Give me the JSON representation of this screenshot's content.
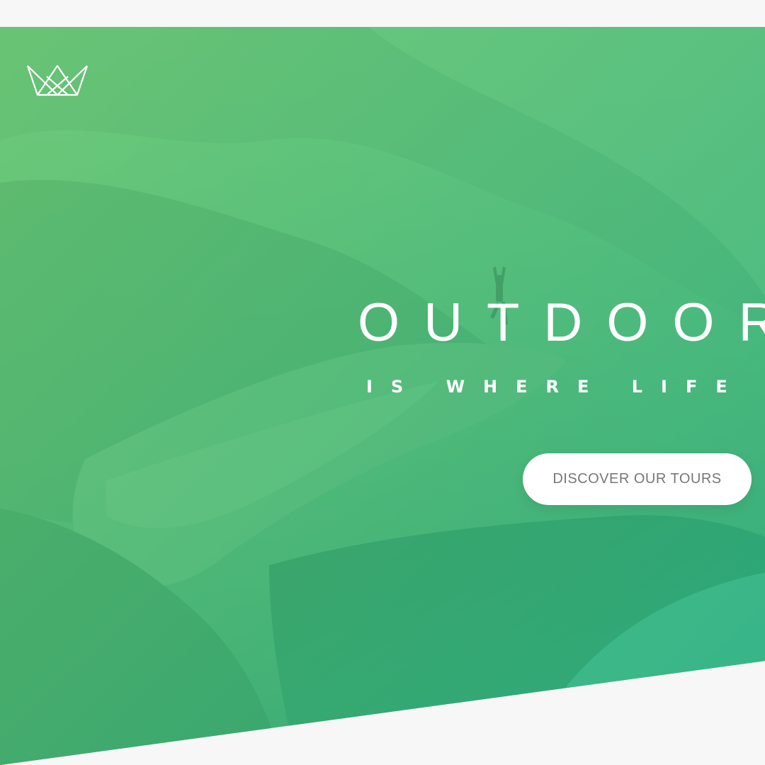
{
  "hero": {
    "heading_primary_main": "OUTDOORS",
    "heading_primary_sub": "IS WHERE LIFE HAPPENS",
    "cta_label": "DISCOVER OUR TOURS",
    "logo_icon": "crown-icon",
    "overlay_colors": [
      "#7ed56f",
      "#28b485"
    ]
  }
}
